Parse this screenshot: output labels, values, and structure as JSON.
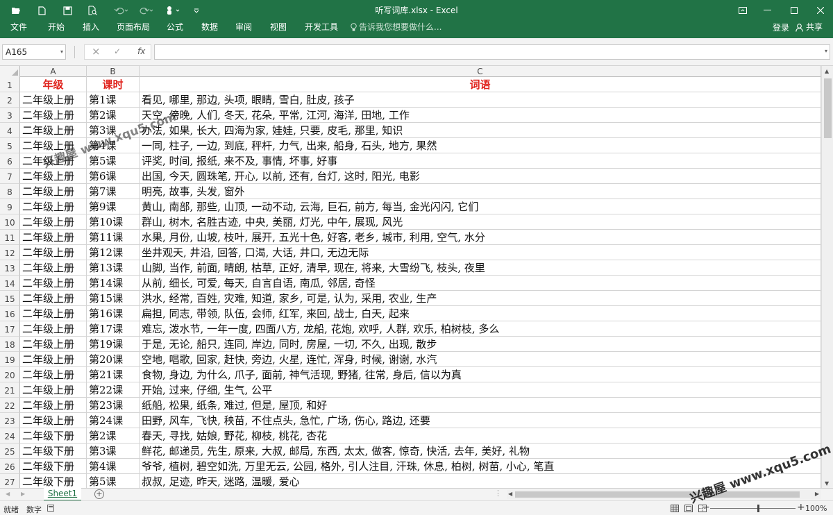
{
  "window": {
    "title": "听写词库.xlsx - Excel",
    "accent": "#217346"
  },
  "quick_access": {
    "icons": [
      "open-icon",
      "new-icon",
      "save-icon",
      "print-preview-icon",
      "undo-icon",
      "redo-icon",
      "touch-mode-icon",
      "customize-icon"
    ]
  },
  "ribbon": {
    "tabs": [
      "文件",
      "开始",
      "插入",
      "页面布局",
      "公式",
      "数据",
      "审阅",
      "视图",
      "开发工具"
    ],
    "tell_me": "告诉我您想要做什么...",
    "login": "登录",
    "share": "共享"
  },
  "formula_bar": {
    "name_box": "A165",
    "cancel": "×",
    "enter": "✓",
    "fx": "fx",
    "formula": ""
  },
  "grid": {
    "columns": [
      "A",
      "B",
      "C"
    ],
    "header_row": {
      "num": "1",
      "a": "年级",
      "b": "课时",
      "c": "词语"
    },
    "rows": [
      {
        "num": "2",
        "a": "二年级上册",
        "b": "第1课",
        "c": "看见, 哪里, 那边, 头项, 眼睛, 雪白, 肚皮, 孩子"
      },
      {
        "num": "3",
        "a": "二年级上册",
        "b": "第2课",
        "c": "天空, 傍晚, 人们, 冬天, 花朵, 平常, 江河, 海洋, 田地, 工作"
      },
      {
        "num": "4",
        "a": "二年级上册",
        "b": "第3课",
        "c": "办法, 如果, 长大, 四海为家, 娃娃, 只要, 皮毛, 那里, 知识"
      },
      {
        "num": "5",
        "a": "二年级上册",
        "b": "第4课",
        "c": "一同, 柱子, 一边, 到底, 秤杆, 力气, 出来, 船身, 石头, 地方, 果然"
      },
      {
        "num": "6",
        "a": "二年级上册",
        "b": "第5课",
        "c": "评奖, 时间, 报纸, 来不及, 事情, 坏事, 好事"
      },
      {
        "num": "7",
        "a": "二年级上册",
        "b": "第6课",
        "c": "出国, 今天, 圆珠笔, 开心, 以前, 还有, 台灯, 这时, 阳光, 电影"
      },
      {
        "num": "8",
        "a": "二年级上册",
        "b": "第7课",
        "c": "明亮, 故事, 头发, 窗外"
      },
      {
        "num": "9",
        "a": "二年级上册",
        "b": "第9课",
        "c": "黄山, 南部, 那些, 山顶, 一动不动, 云海, 巨石, 前方, 每当, 金光闪闪, 它们"
      },
      {
        "num": "10",
        "a": "二年级上册",
        "b": "第10课",
        "c": "群山, 树木, 名胜古迹, 中央, 美丽, 灯光, 中午, 展现, 风光"
      },
      {
        "num": "11",
        "a": "二年级上册",
        "b": "第11课",
        "c": "水果, 月份, 山坡, 枝叶, 展开, 五光十色, 好客, 老乡, 城市, 利用, 空气, 水分"
      },
      {
        "num": "12",
        "a": "二年级上册",
        "b": "第12课",
        "c": "坐井观天, 井沿, 回答, 口渴, 大话, 井口, 无边无际"
      },
      {
        "num": "13",
        "a": "二年级上册",
        "b": "第13课",
        "c": "山脚, 当作, 前面, 晴朗, 枯草, 正好, 清早, 现在, 将来, 大雪纷飞, 枝头, 夜里"
      },
      {
        "num": "14",
        "a": "二年级上册",
        "b": "第14课",
        "c": "从前, 细长, 可爱, 每天, 自言自语, 南瓜, 邻居, 奇怪"
      },
      {
        "num": "15",
        "a": "二年级上册",
        "b": "第15课",
        "c": "洪水, 经常, 百姓, 灾难, 知道, 家乡, 可是, 认为, 采用, 农业, 生产"
      },
      {
        "num": "16",
        "a": "二年级上册",
        "b": "第16课",
        "c": "扁担, 同志, 带领, 队伍, 会师, 红军, 来回, 战士, 白天, 起来"
      },
      {
        "num": "17",
        "a": "二年级上册",
        "b": "第17课",
        "c": "难忘, 泼水节, 一年一度, 四面八方, 龙船, 花炮, 欢呼, 人群, 欢乐, 柏树枝, 多么"
      },
      {
        "num": "18",
        "a": "二年级上册",
        "b": "第19课",
        "c": "于是, 无论, 船只, 连同, 岸边, 同时, 房屋, 一切, 不久, 出现, 散步"
      },
      {
        "num": "19",
        "a": "二年级上册",
        "b": "第20课",
        "c": "空地, 唱歌, 回家, 赶快, 旁边, 火星, 连忙, 浑身, 时候, 谢谢, 水汽"
      },
      {
        "num": "20",
        "a": "二年级上册",
        "b": "第21课",
        "c": "食物, 身边, 为什么, 爪子, 面前, 神气活现, 野猪, 往常, 身后, 信以为真"
      },
      {
        "num": "21",
        "a": "二年级上册",
        "b": "第22课",
        "c": "开始, 过来, 仔细, 生气, 公平"
      },
      {
        "num": "22",
        "a": "二年级上册",
        "b": "第23课",
        "c": "纸船, 松果, 纸条, 难过, 但是, 屋顶, 和好"
      },
      {
        "num": "23",
        "a": "二年级上册",
        "b": "第24课",
        "c": "田野, 风车, 飞快, 秧苗, 不住点头, 急忙, 广场, 伤心, 路边, 还要"
      },
      {
        "num": "24",
        "a": "二年级下册",
        "b": "第2课",
        "c": "春天, 寻找, 姑娘, 野花, 柳枝, 桃花, 杏花"
      },
      {
        "num": "25",
        "a": "二年级下册",
        "b": "第3课",
        "c": "鲜花, 邮递员, 先生, 原来, 大叔, 邮局, 东西, 太太, 做客, 惊奇, 快活, 去年, 美好, 礼物"
      },
      {
        "num": "26",
        "a": "二年级下册",
        "b": "第4课",
        "c": "爷爷, 植树, 碧空如洗, 万里无云, 公园, 格外, 引人注目, 汗珠, 休息, 柏树, 树苗, 小心, 笔直"
      },
      {
        "num": "27",
        "a": "二年级下册",
        "b": "第5课",
        "c": "叔叔, 足迹, 昨天, 迷路, 温暖, 爱心"
      }
    ]
  },
  "sheets": {
    "active": "Sheet1"
  },
  "status": {
    "mode": "就绪",
    "numlock": "数字",
    "zoom": "100%",
    "zoom_minus": "−",
    "zoom_plus": "+"
  },
  "watermarks": {
    "top": "兴趣屋 www.xqu5.com",
    "bottom": "兴趣屋 www.xqu5.com"
  }
}
